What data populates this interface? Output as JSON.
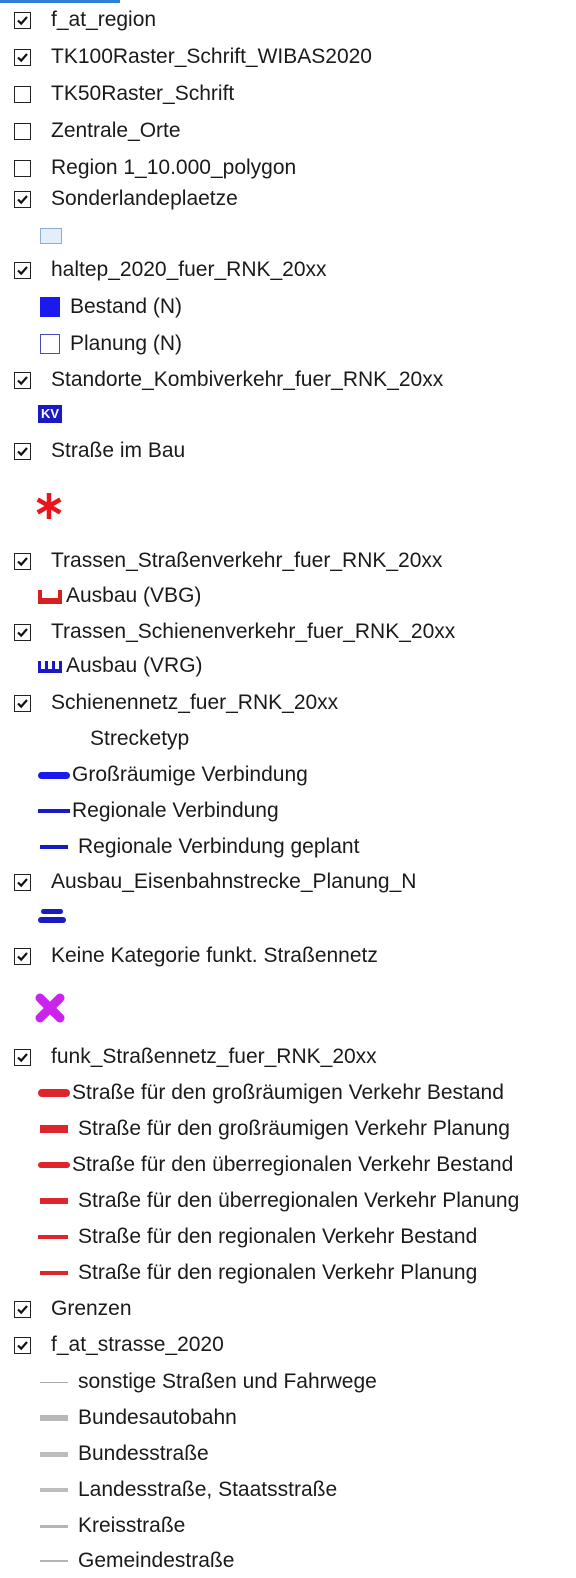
{
  "colors": {
    "checkbox_border": "#222222",
    "legend_blue": "#1a1aee",
    "legend_red": "#e0242b",
    "legend_magenta": "#cc22ee",
    "legend_grey": "#b8b8b8",
    "accent_top": "#2f7fd8"
  },
  "layers": [
    {
      "label": "f_at_region",
      "checked": true
    },
    {
      "label": "TK100Raster_Schrift_WIBAS2020",
      "checked": true
    },
    {
      "label": "TK50Raster_Schrift",
      "checked": false
    },
    {
      "label": "Zentrale_Orte",
      "checked": false
    },
    {
      "label": "Region 1_10.000_polygon",
      "checked": false
    },
    {
      "label": "Sonderlandeplaetze",
      "checked": true
    },
    {
      "label": "haltep_2020_fuer_RNK_20xx",
      "checked": true
    },
    {
      "label": "Standorte_Kombiverkehr_fuer_RNK_20xx",
      "checked": true
    },
    {
      "label": "Straße im Bau",
      "checked": true
    },
    {
      "label": "Trassen_Straßenverkehr_fuer_RNK_20xx",
      "checked": true
    },
    {
      "label": "Trassen_Schienenverkehr_fuer_RNK_20xx",
      "checked": true
    },
    {
      "label": "Schienennetz_fuer_RNK_20xx",
      "checked": true
    },
    {
      "label": "Ausbau_Eisenbahnstrecke_Planung_N",
      "checked": true
    },
    {
      "label": "Keine Kategorie funkt. Straßennetz",
      "checked": true
    },
    {
      "label": "funk_Straßennetz_fuer_RNK_20xx",
      "checked": true
    },
    {
      "label": "Grenzen",
      "checked": true
    },
    {
      "label": "f_at_strasse_2020",
      "checked": true
    }
  ],
  "legend": {
    "haltep": [
      "Bestand (N)",
      "Planung (N)"
    ],
    "kv_badge": "KV",
    "trassen_strasse": "Ausbau (VBG)",
    "trassen_schiene": "Ausbau (VRG)",
    "schienennetz_header": "Strecketyp",
    "schienennetz": [
      "Großräumige Verbindung",
      "Regionale Verbindung",
      "Regionale Verbindung geplant"
    ],
    "funk_strassennetz": [
      "Straße für den großräumigen Verkehr Bestand",
      "Straße für den großräumigen Verkehr Planung",
      "Straße für den überregionalen Verkehr Bestand",
      "Straße für den überregionalen Verkehr Planung",
      "Straße für den regionalen Verkehr Bestand",
      "Straße für den regionalen Verkehr Planung"
    ],
    "strasse_2020": [
      "sonstige Straßen und Fahrwege",
      "Bundesautobahn",
      "Bundesstraße",
      "Landesstraße, Staatsstraße",
      "Kreisstraße",
      "Gemeindestraße"
    ]
  }
}
